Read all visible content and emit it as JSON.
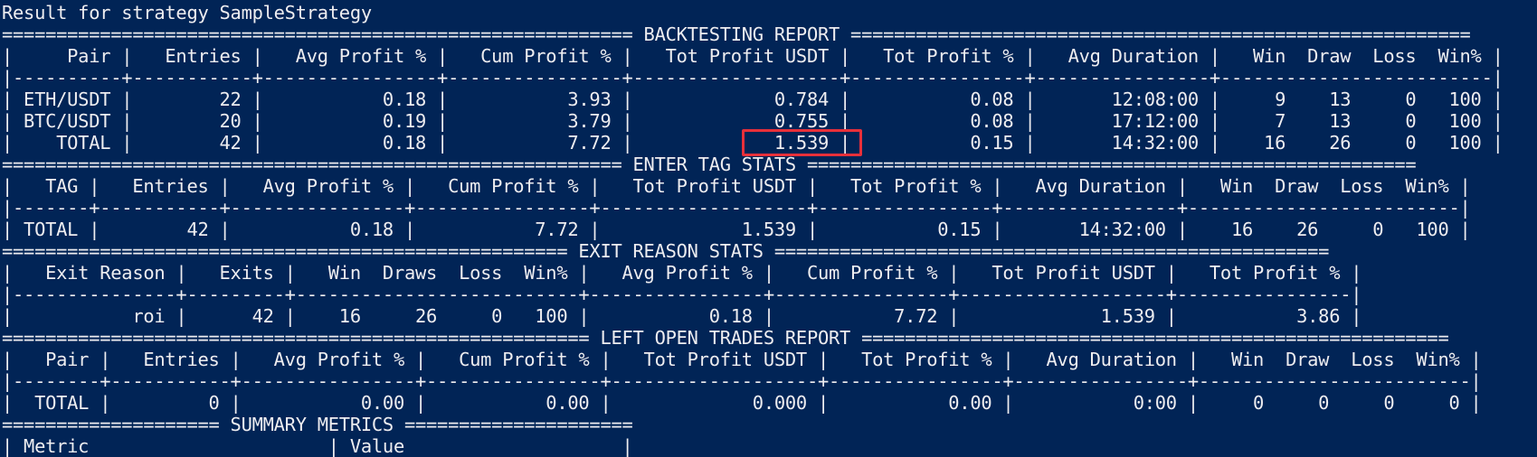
{
  "terminal": {
    "lines": [
      "Result for strategy SampleStrategy",
      "========================================================== BACKTESTING REPORT =========================================================",
      "|     Pair |   Entries |   Avg Profit % |   Cum Profit % |   Tot Profit USDT |   Tot Profit % |   Avg Duration |   Win  Draw  Loss  Win% |",
      "|----------+-----------+----------------+----------------+-------------------+----------------+----------------+-------------------------|",
      "| ETH/USDT |        22 |           0.18 |           3.93 |             0.784 |           0.08 |       12:08:00 |     9    13     0   100 |",
      "| BTC/USDT |        20 |           0.19 |           3.79 |             0.755 |           0.08 |       17:12:00 |     7    13     0   100 |",
      "|    TOTAL |        42 |           0.18 |           7.72 |             1.539 |           0.15 |       14:32:00 |    16    26     0   100 |",
      "========================================================= ENTER TAG STATS ========================================================",
      "|   TAG |   Entries |   Avg Profit % |   Cum Profit % |   Tot Profit USDT |   Tot Profit % |   Avg Duration |   Win  Draw  Loss  Win% |",
      "|-------+-----------+----------------+----------------+-------------------+----------------+----------------+-------------------------|",
      "| TOTAL |        42 |           0.18 |           7.72 |             1.539 |           0.15 |       14:32:00 |    16    26     0   100 |",
      "==================================================== EXIT REASON STATS ===================================================",
      "|   Exit Reason |   Exits |   Win  Draws  Loss  Win% |   Avg Profit % |   Cum Profit % |   Tot Profit USDT |   Tot Profit % |",
      "|---------------+---------+--------------------------+----------------+----------------+-------------------+----------------|",
      "|           roi |      42 |    16     26     0   100 |           0.18 |           7.72 |             1.539 |           3.86 |",
      "====================================================== LEFT OPEN TRADES REPORT ======================================================",
      "|   Pair |   Entries |   Avg Profit % |   Cum Profit % |   Tot Profit USDT |   Tot Profit % |   Avg Duration |   Win  Draw  Loss  Win% |",
      "|--------+-----------+----------------+----------------+-------------------+----------------+----------------+-------------------------|",
      "|  TOTAL |         0 |           0.00 |           0.00 |             0.000 |           0.00 |           0:00 |     0     0     0     0 |",
      "==================== SUMMARY METRICS =====================",
      "| Metric                      | Value                    |"
    ]
  },
  "highlight": {
    "color": "#e8303a",
    "target_value": "1.539"
  },
  "colors": {
    "background": "#012456",
    "foreground": "#eeedf0"
  }
}
